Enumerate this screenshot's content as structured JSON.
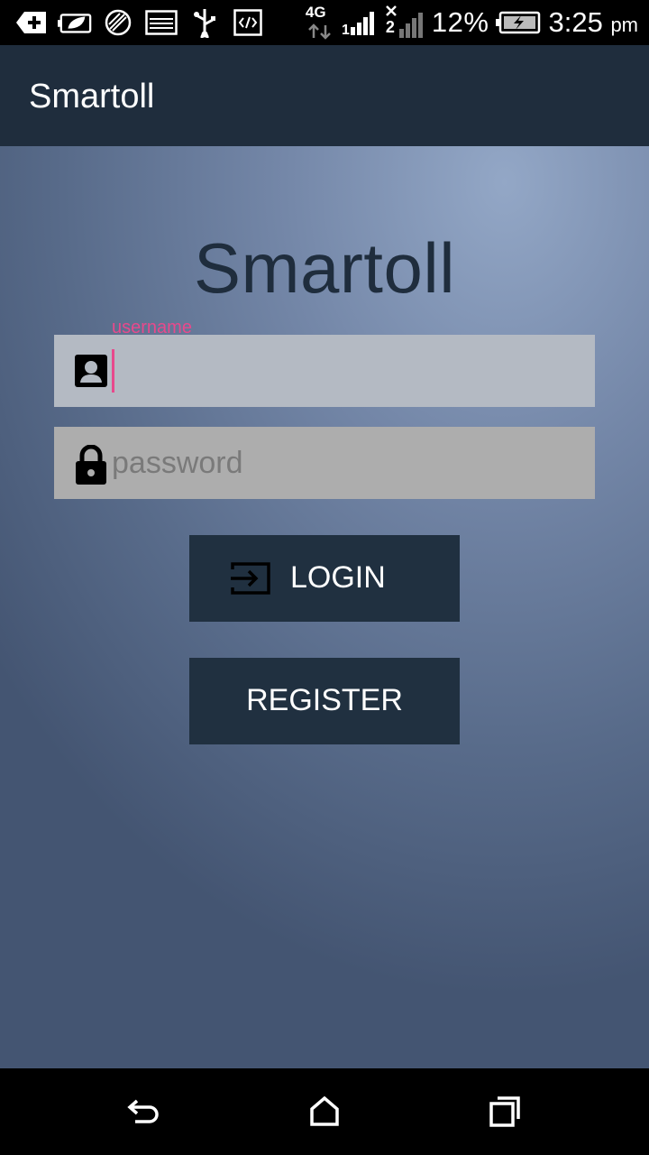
{
  "status_bar": {
    "network": "4G",
    "sim2": "2",
    "battery_percent": "12%",
    "time": "3:25",
    "ampm": "pm",
    "icons": [
      "add-icon",
      "battery-leaf-icon",
      "browser-icon",
      "image-icon",
      "usb-icon",
      "code-icon",
      "signal-icon",
      "signal-x-icon",
      "battery-charging-icon"
    ]
  },
  "app_bar": {
    "title": "Smartoll"
  },
  "login": {
    "logo_title": "Smartoll",
    "username_label": "username",
    "password_placeholder": "password",
    "login_label": "LOGIN",
    "register_label": "REGISTER"
  },
  "nav_bar": {
    "icons": [
      "back-icon",
      "home-icon",
      "recent-apps-icon"
    ]
  },
  "colors": {
    "primary": "#1f2d3d",
    "accent": "#e8498c",
    "button": "#203040"
  }
}
